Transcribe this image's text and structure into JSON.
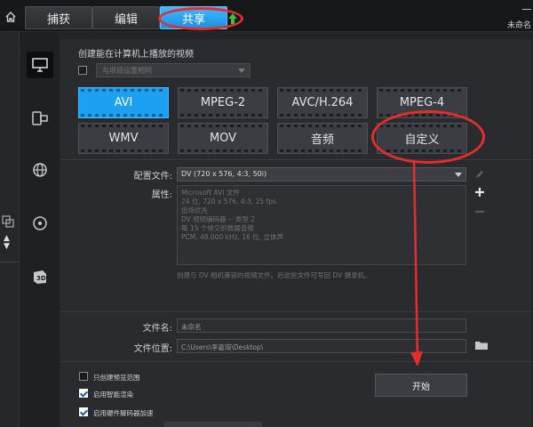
{
  "topbar": {
    "home_icon": "home-icon",
    "tabs": [
      {
        "label": "捕获"
      },
      {
        "label": "编辑"
      },
      {
        "label": "共享",
        "active": true
      }
    ],
    "upload_icon": "upload-arrow-icon",
    "project_name": "未命名",
    "accent_color": "#1c8fe0"
  },
  "sidebar": {
    "items": [
      {
        "icon": "monitor-icon",
        "active": true
      },
      {
        "icon": "device-icon"
      },
      {
        "icon": "globe-icon"
      },
      {
        "icon": "disc-icon"
      },
      {
        "icon": "3d-icon",
        "text": "3D"
      }
    ]
  },
  "main": {
    "heading": "创建能在计算机上播放的视频",
    "preset": {
      "checked": false,
      "placeholder": "与项目设置相同"
    },
    "formats": [
      {
        "label": "AVI",
        "active": true
      },
      {
        "label": "MPEG-2"
      },
      {
        "label": "AVC/H.264"
      },
      {
        "label": "MPEG-4"
      },
      {
        "label": "WMV"
      },
      {
        "label": "MOV"
      },
      {
        "label": "音频"
      },
      {
        "label": "自定义"
      }
    ],
    "profile_label": "配置文件:",
    "profile_value": "DV (720 x 576, 4:3, 50i)",
    "properties_label": "属性:",
    "properties_lines": [
      "Microsoft AVI 文件",
      "24 位, 720 x 576, 4:3, 25 fps",
      "低场优先",
      "DV 视频编码器 -- 类型 2",
      "每 15 个帧交织数据音频",
      "PCM, 48.000 kHz, 16 位, 立体声"
    ],
    "description": "创建与 DV 相机兼容的视频文件。后这些文件可写回 DV 摄录机。",
    "filename_label": "文件名:",
    "filename_value": "未命名",
    "location_label": "文件位置:",
    "location_value": "C:\\Users\\李嘉琦\\Desktop\\",
    "options": [
      {
        "label": "只创建预览范围",
        "checked": false
      },
      {
        "label": "启用智能渲染",
        "checked": true
      },
      {
        "label": "启用硬件解码器加速",
        "checked": true
      }
    ],
    "start_label": "开始"
  },
  "annotation_color": "#e52d2d"
}
